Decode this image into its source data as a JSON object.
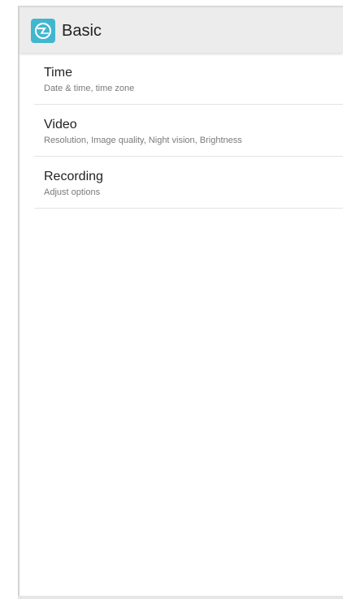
{
  "header": {
    "title": "Basic",
    "icon": "camera-lens-icon",
    "accent_color": "#42b6cf"
  },
  "settings": {
    "items": [
      {
        "title": "Time",
        "subtitle": "Date & time, time zone"
      },
      {
        "title": "Video",
        "subtitle": "Resolution, Image quality, Night vision, Brightness"
      },
      {
        "title": "Recording",
        "subtitle": "Adjust options"
      }
    ]
  }
}
